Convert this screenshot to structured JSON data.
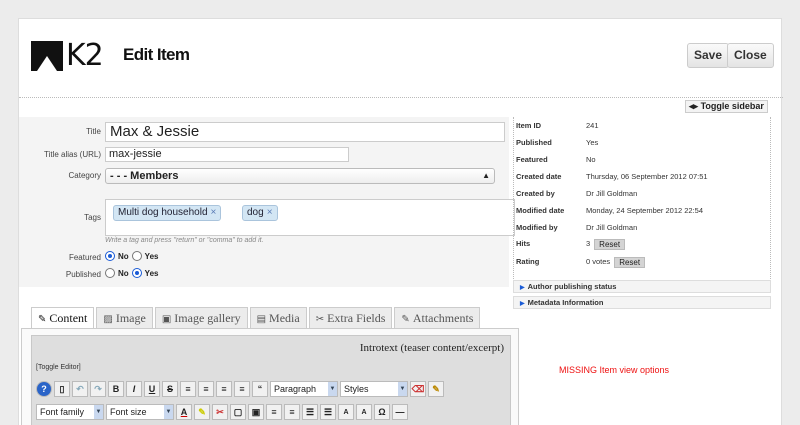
{
  "header": {
    "logo_text": "K2",
    "title": "Edit Item",
    "save_label": "Save",
    "close_label": "Close",
    "toggle_sidebar_label": "Toggle sidebar",
    "toggle_sidebar_icon": "◂▸"
  },
  "form": {
    "title_label": "Title",
    "title_value": "Max & Jessie",
    "alias_label": "Title alias (URL)",
    "alias_value": "max-jessie",
    "category_label": "Category",
    "category_value": "- - - Members",
    "tags_label": "Tags",
    "tags": [
      "Multi dog household",
      "dog"
    ],
    "tag_remove_glyph": "×",
    "tags_hint": "Write a tag and press \"return\" or \"comma\" to add it.",
    "featured_label": "Featured",
    "published_label": "Published",
    "no_label": "No",
    "yes_label": "Yes",
    "featured_value": "No",
    "published_value": "Yes"
  },
  "tabs": [
    {
      "label": "Content",
      "icon": "✎",
      "active": true
    },
    {
      "label": "Image",
      "icon": "▨",
      "active": false
    },
    {
      "label": "Image gallery",
      "icon": "▣",
      "active": false
    },
    {
      "label": "Media",
      "icon": "▤",
      "active": false
    },
    {
      "label": "Extra Fields",
      "icon": "✂",
      "active": false
    },
    {
      "label": "Attachments",
      "icon": "✎",
      "active": false
    }
  ],
  "editor": {
    "heading": "Introtext (teaser content/excerpt)",
    "toggle_label": "[Toggle Editor]",
    "format_select": "Paragraph",
    "styles_select": "Styles",
    "font_family_select": "Font family",
    "font_size_select": "Font size",
    "toolbar1": [
      "?",
      "▯",
      "↶",
      "↷",
      "B",
      "I",
      "U",
      "S",
      "≡",
      "≡",
      "≡",
      "≡",
      "“"
    ],
    "toolbar2": [
      "A",
      "✎",
      "✂",
      "▢",
      "▣",
      "≡",
      "≡",
      "☰",
      "☰",
      "A",
      "A",
      "Ω",
      "—"
    ]
  },
  "sidebar": {
    "rows": [
      {
        "key": "Item ID",
        "value": "241"
      },
      {
        "key": "Published",
        "value": "Yes"
      },
      {
        "key": "Featured",
        "value": "No"
      },
      {
        "key": "Created date",
        "value": "Thursday, 06 September 2012 07:51"
      },
      {
        "key": "Created by",
        "value": "Dr Jill Goldman"
      },
      {
        "key": "Modified date",
        "value": "Monday, 24 September 2012 22:54"
      },
      {
        "key": "Modified by",
        "value": "Dr Jill Goldman"
      },
      {
        "key": "Hits",
        "value": "3"
      },
      {
        "key": "Rating",
        "value": "0 votes"
      }
    ],
    "reset_label": "Reset",
    "sections": [
      "Author publishing status",
      "Metadata Information"
    ],
    "section_icon": "▶"
  },
  "missing_text": "MISSING Item view options"
}
